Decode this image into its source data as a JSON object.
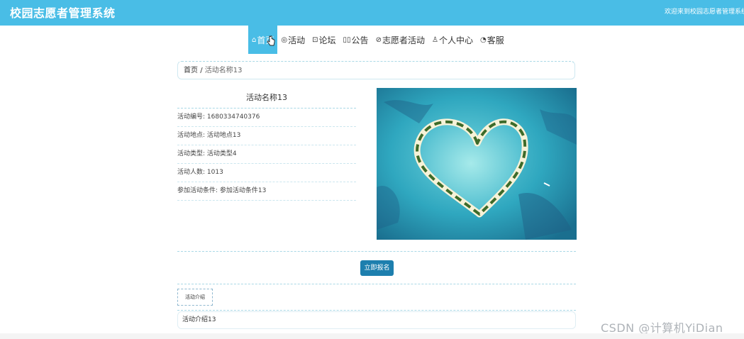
{
  "header": {
    "title": "校园志愿者管理系统",
    "welcome": "欢迎来到校园志愿者管理系统"
  },
  "nav": {
    "items": [
      {
        "icon": "⌂",
        "label": "首页",
        "active": true
      },
      {
        "icon": "◎",
        "label": "活动"
      },
      {
        "icon": "⊡",
        "label": "论坛"
      },
      {
        "icon": "▯▯",
        "label": "公告"
      },
      {
        "icon": "⊘",
        "label": "志愿者活动"
      },
      {
        "icon": "♙",
        "label": "个人中心"
      },
      {
        "icon": "◔",
        "label": "客服"
      }
    ]
  },
  "breadcrumb": {
    "home": "首页",
    "separator": "/",
    "current": "活动名称13"
  },
  "detail": {
    "title": "活动名称13",
    "fields": [
      "活动编号: 1680334740376",
      "活动地点: 活动地点13",
      "活动类型: 活动类型4",
      "活动人数: 1013",
      "参加活动条件: 参加活动条件13"
    ]
  },
  "actions": {
    "signup": "立即报名"
  },
  "tabs": {
    "intro_tab": "活动介绍"
  },
  "intro": {
    "content": "活动介绍13"
  },
  "watermark": "CSDN @计算机YiDian",
  "colors": {
    "primary": "#49bde6",
    "button": "#1d7fae"
  }
}
